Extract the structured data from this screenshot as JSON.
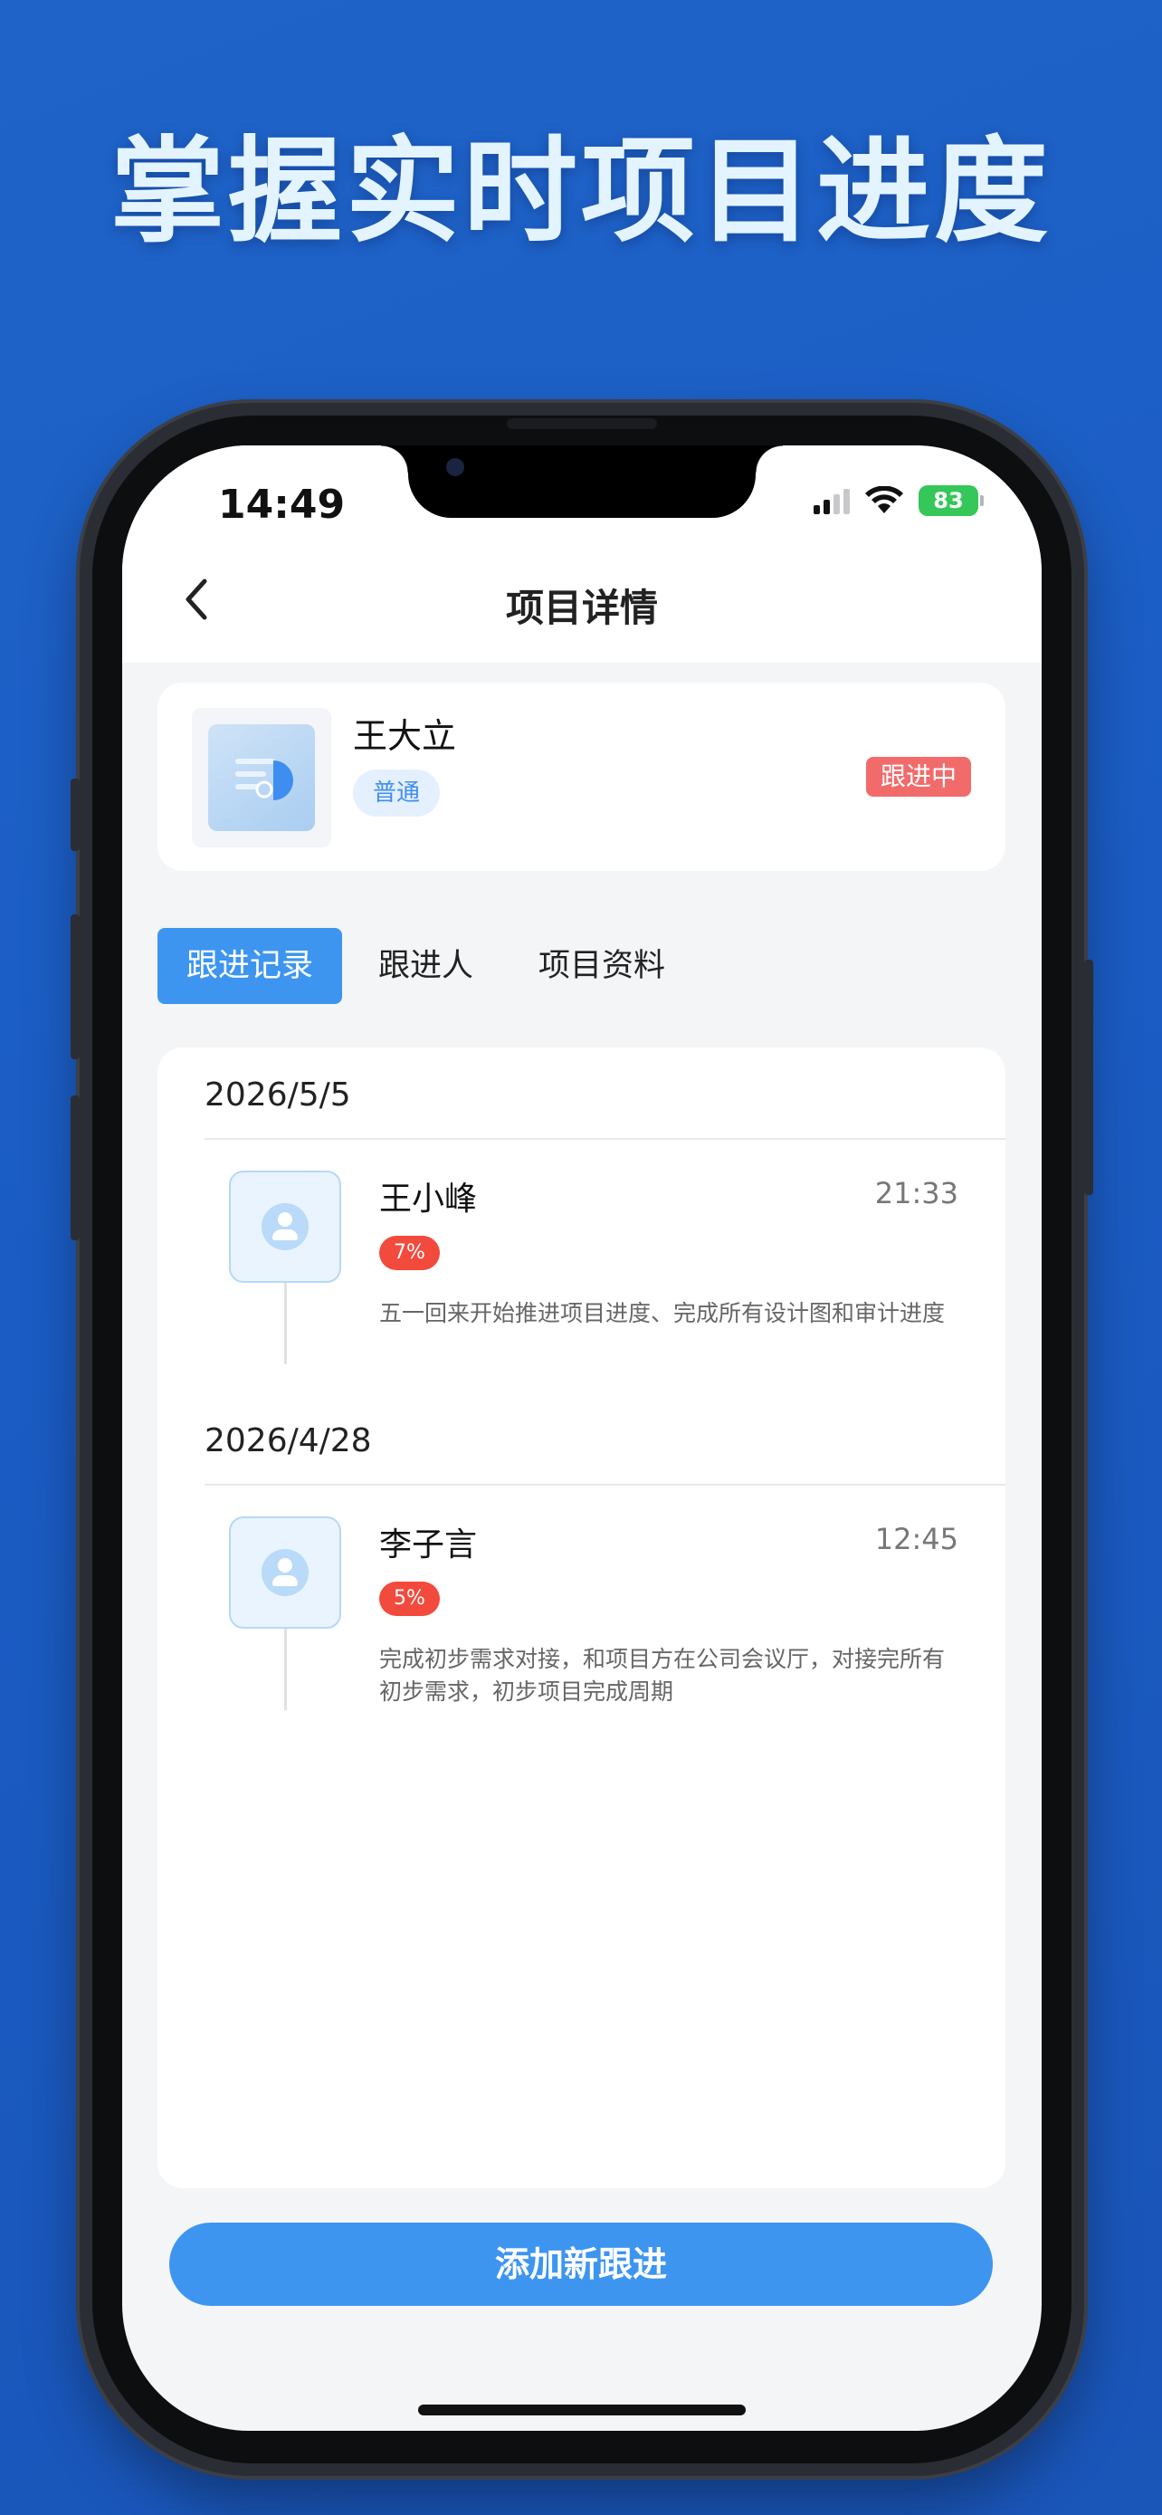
{
  "headline": "掌握实时项目进度",
  "status_bar": {
    "time": "14:49",
    "battery": "83"
  },
  "nav": {
    "title": "项目详情"
  },
  "profile": {
    "name": "王大立",
    "tag": "普通",
    "status": "跟进中"
  },
  "tabs": [
    {
      "label": "跟进记录",
      "active": true
    },
    {
      "label": "跟进人",
      "active": false
    },
    {
      "label": "项目资料",
      "active": false
    }
  ],
  "records": [
    {
      "date": "2026/5/5",
      "name": "王小峰",
      "time": "21:33",
      "percent": "7%",
      "description": "五一回来开始推进项目进度、完成所有设计图和审计进度"
    },
    {
      "date": "2026/4/28",
      "name": "李子言",
      "time": "12:45",
      "percent": "5%",
      "description": "完成初步需求对接，和项目方在公司会议厅，对接完所有初步需求，初步项目完成周期"
    }
  ],
  "actions": {
    "add_label": "添加新跟进"
  },
  "colors": {
    "accent": "#3d95f0",
    "badge_red": "#f26b6b",
    "percent_red": "#f24a3d",
    "background_blue": "#1a5cc4"
  }
}
